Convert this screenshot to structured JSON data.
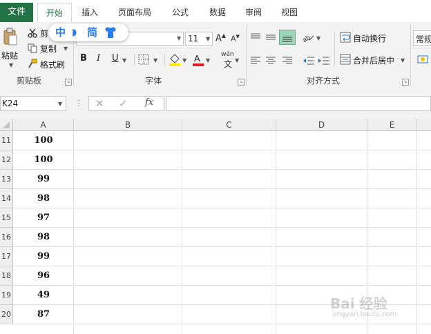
{
  "ribbon_tabs": [
    {
      "label": "文件"
    },
    {
      "label": "开始"
    },
    {
      "label": "插入"
    },
    {
      "label": "页面布局"
    },
    {
      "label": "公式"
    },
    {
      "label": "数据"
    },
    {
      "label": "审阅"
    },
    {
      "label": "视图"
    }
  ],
  "active_tab": "开始",
  "clipboard": {
    "paste_label": "粘贴",
    "cut_label": "剪",
    "copy_label": "复制",
    "format_painter_label": "格式刷",
    "group_label": "剪贴板"
  },
  "font": {
    "size": "11",
    "bold": "B",
    "italic": "I",
    "underline": "U",
    "phonetic": "wén",
    "group_label": "字体"
  },
  "alignment": {
    "wrap_text": "自动换行",
    "merge_center": "合并后居中",
    "group_label": "对齐方式"
  },
  "number": {
    "format": "常规"
  },
  "ime_bar": {
    "lang": "中",
    "mode": "简"
  },
  "formula_bar": {
    "name_box": "K24",
    "fx": "fx",
    "value": ""
  },
  "grid": {
    "columns": [
      "A",
      "B",
      "C",
      "D",
      "E"
    ],
    "rows": [
      {
        "num": "11",
        "a": "100"
      },
      {
        "num": "12",
        "a": "100"
      },
      {
        "num": "13",
        "a": "99"
      },
      {
        "num": "14",
        "a": "98"
      },
      {
        "num": "15",
        "a": "97"
      },
      {
        "num": "16",
        "a": "98"
      },
      {
        "num": "17",
        "a": "99"
      },
      {
        "num": "18",
        "a": "96"
      },
      {
        "num": "19",
        "a": "49"
      },
      {
        "num": "20",
        "a": "87"
      }
    ]
  },
  "colors": {
    "excel_green": "#217346",
    "ime_blue": "#2a7ff0",
    "fill_yellow": "#ffeb00",
    "font_red": "#e02020",
    "highlight_green": "#9fd5b7"
  },
  "watermark": {
    "brand": "Bai 经验",
    "url": "jingyan.baidu.com"
  }
}
